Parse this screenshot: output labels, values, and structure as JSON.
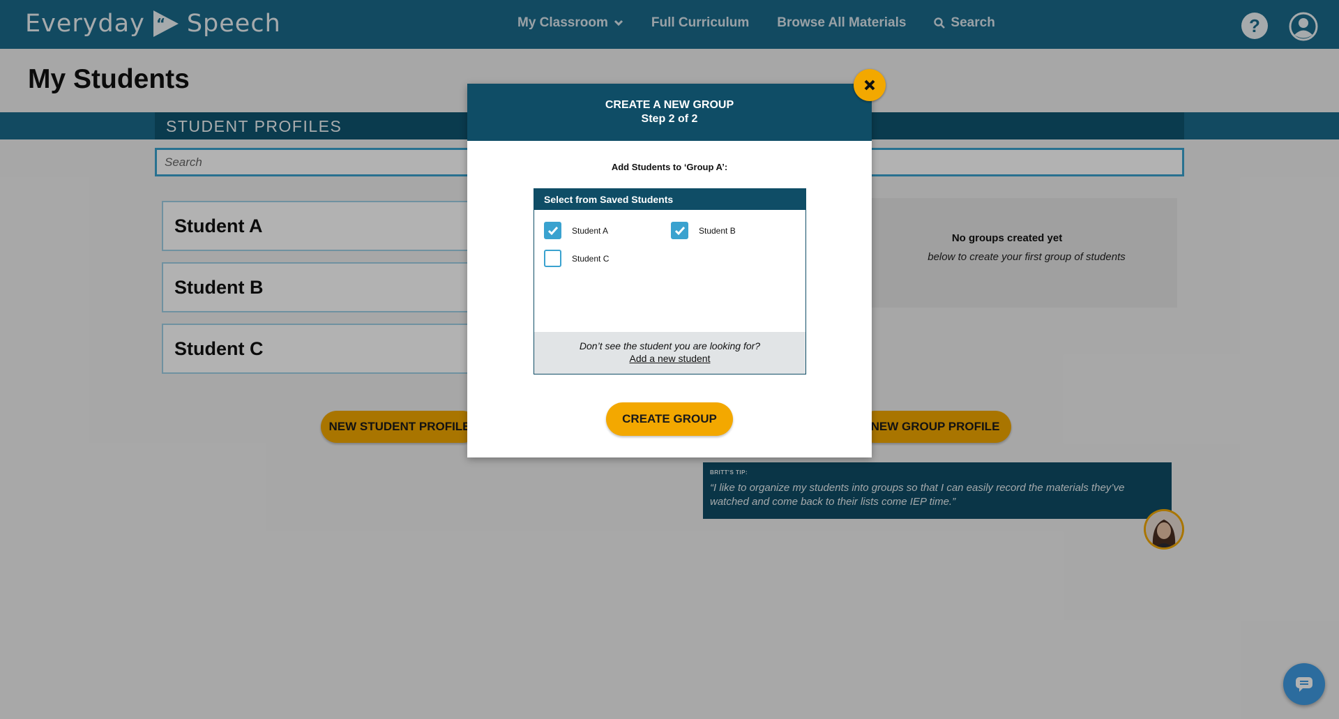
{
  "header": {
    "logo_left": "Everyday",
    "logo_right": "Speech",
    "nav": {
      "my_classroom": "My Classroom",
      "full_curriculum": "Full Curriculum",
      "browse_all": "Browse All Materials",
      "search": "Search"
    },
    "icons": [
      "help-icon",
      "user-icon",
      "search-icon",
      "chevron-down-icon"
    ]
  },
  "page": {
    "title": "My Students",
    "section_title": "STUDENT PROFILES",
    "search_placeholder": "Search",
    "students": [
      "Student A",
      "Student B",
      "Student C"
    ],
    "groups_empty_title": "No groups created yet",
    "groups_empty_sub": "below to create your first group of students",
    "new_student_button": "NEW STUDENT PROFILE",
    "new_group_button": "NEW GROUP PROFILE"
  },
  "tip": {
    "label": "BRITT'S TIP:",
    "text": "“I like to organize my students into groups so that I can easily record the materials they’ve watched and come back to their lists come IEP time.”"
  },
  "modal": {
    "title": "CREATE A NEW GROUP",
    "step": "Step 2 of 2",
    "prompt": "Add Students to ‘Group A’:",
    "picker_title": "Select from Saved Students",
    "options": [
      {
        "label": "Student A",
        "checked": true
      },
      {
        "label": "Student B",
        "checked": true
      },
      {
        "label": "Student C",
        "checked": false
      }
    ],
    "footer_question": "Don’t see the student you are looking for?",
    "footer_link": "Add a new student",
    "create_button": "CREATE GROUP"
  },
  "colors": {
    "nav_blue": "#1a6a8b",
    "dark_teal": "#0f4d66",
    "accent_orange": "#f3a800",
    "checkbox_blue": "#3aa2cf"
  }
}
